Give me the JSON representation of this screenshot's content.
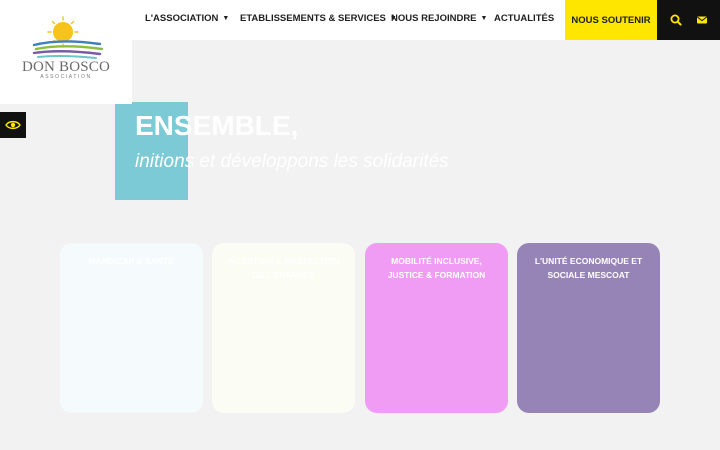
{
  "logo": {
    "name": "DON BOSCO",
    "subtitle": "ASSOCIATION",
    "colors": {
      "sun": "#f6c21c",
      "blue": "#3e7fbf",
      "green": "#8bbf3a",
      "purple": "#7b5aa6",
      "teal": "#6cc3c9"
    }
  },
  "nav": {
    "items": [
      {
        "label": "L'ASSOCIATION",
        "has_dropdown": true
      },
      {
        "label": "ETABLISSEMENTS & SERVICES",
        "has_dropdown": true
      },
      {
        "label": "NOUS REJOINDRE",
        "has_dropdown": true
      },
      {
        "label": "ACTUALITÉS",
        "has_dropdown": false
      }
    ],
    "support_label": "NOUS SOUTENIR",
    "support_color": "#ffe600",
    "icons": [
      "search-icon",
      "envelope-icon"
    ]
  },
  "accessibility": {
    "icon": "eye-icon"
  },
  "hero": {
    "title": "ENSEMBLE,",
    "subtitle": "initions et développons les solidarités",
    "accent_color": "#7ccad6"
  },
  "cards": [
    {
      "label": "HANDICAP & SANTÉ",
      "color": "#f5fbfc"
    },
    {
      "label": "INSERTION & PROTECTION DE L'ENFANCE",
      "color": "#fbfcf3"
    },
    {
      "label": "MOBILITÉ INCLUSIVE, JUSTICE & FORMATION",
      "color": "#f09cf5"
    },
    {
      "label": "L'UNITÉ ECONOMIQUE ET SOCIALE MESCOAT",
      "color": "#9784b6"
    }
  ]
}
